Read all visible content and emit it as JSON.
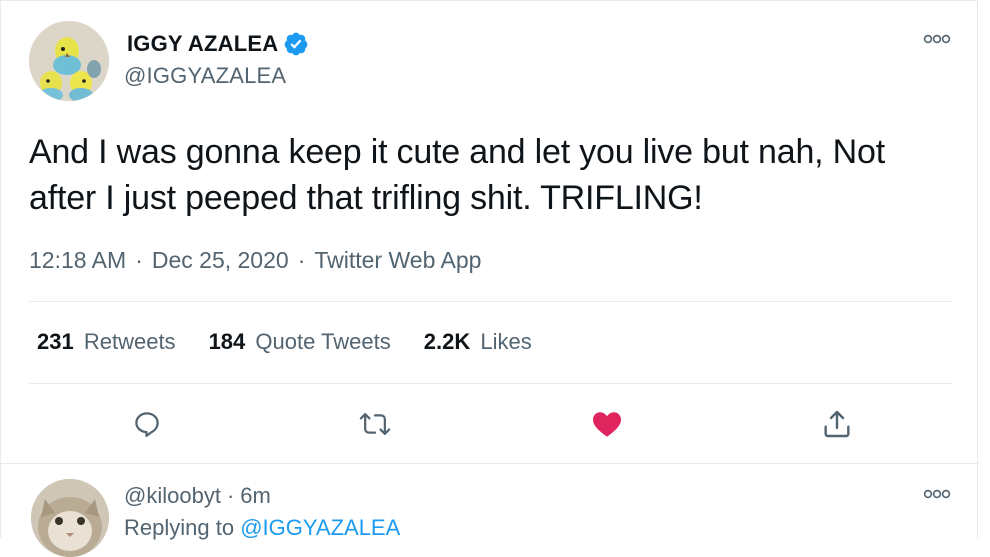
{
  "tweet": {
    "display_name": "IGGY AZALEA",
    "handle": "@IGGYAZALEA",
    "verified": true,
    "text": "And I was gonna keep it cute and let you live but nah, Not after I just peeped that trifling shit. TRIFLING!",
    "time": "12:18 AM",
    "date": "Dec 25, 2020",
    "source": "Twitter Web App",
    "separator": "·"
  },
  "stats": {
    "retweets_count": "231",
    "retweets_label": "Retweets",
    "quote_count": "184",
    "quote_label": "Quote Tweets",
    "likes_count": "2.2K",
    "likes_label": "Likes"
  },
  "actions": {
    "reply_icon": "reply-icon",
    "retweet_icon": "retweet-icon",
    "like_icon": "heart-filled-icon",
    "share_icon": "share-icon"
  },
  "reply": {
    "handle": "@kiloobyt",
    "age": "6m",
    "separator": "·",
    "replying_prefix": "Replying to",
    "replying_to": "@IGGYAZALEA"
  },
  "colors": {
    "accent": "#1d9bf0",
    "like": "#e0245e",
    "muted": "#536471",
    "text": "#0f1419",
    "divider": "#e6ecf0"
  }
}
